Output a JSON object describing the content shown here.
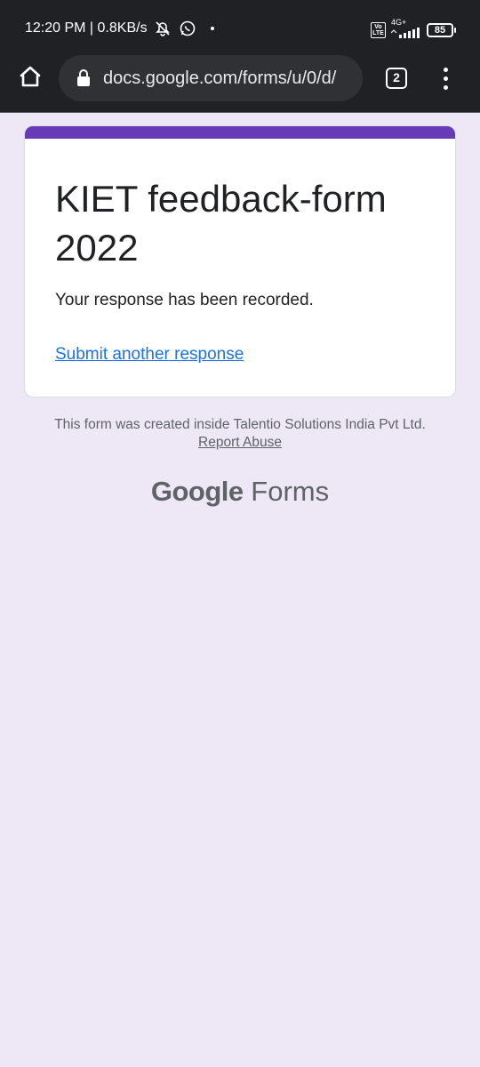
{
  "status_bar": {
    "time_speed": "12:20 PM | 0.8KB/s",
    "network": "4G+",
    "volte": "Vo LTE",
    "battery": "85",
    "icons": [
      "mute-alarm-icon",
      "whatsapp-icon",
      "dot-icon",
      "signal-icon",
      "battery-icon"
    ]
  },
  "browser": {
    "url": "docs.google.com/forms/u/0/d/",
    "tab_count": "2",
    "icons": [
      "home-icon",
      "lock-icon",
      "tabs-icon",
      "more-vert-icon"
    ]
  },
  "form": {
    "title": "KIET feedback-form 2022",
    "confirmation": "Your response has been recorded.",
    "another_link": "Submit another response",
    "accent_color": "#673ab7"
  },
  "footer": {
    "note": "This form was created inside Talentio Solutions India Pvt Ltd.",
    "report_link": "Report Abuse",
    "brand_google": "Google",
    "brand_forms": "Forms"
  },
  "colors": {
    "background": "#ede7f6",
    "link": "#1a73e8",
    "chrome": "#202124"
  }
}
